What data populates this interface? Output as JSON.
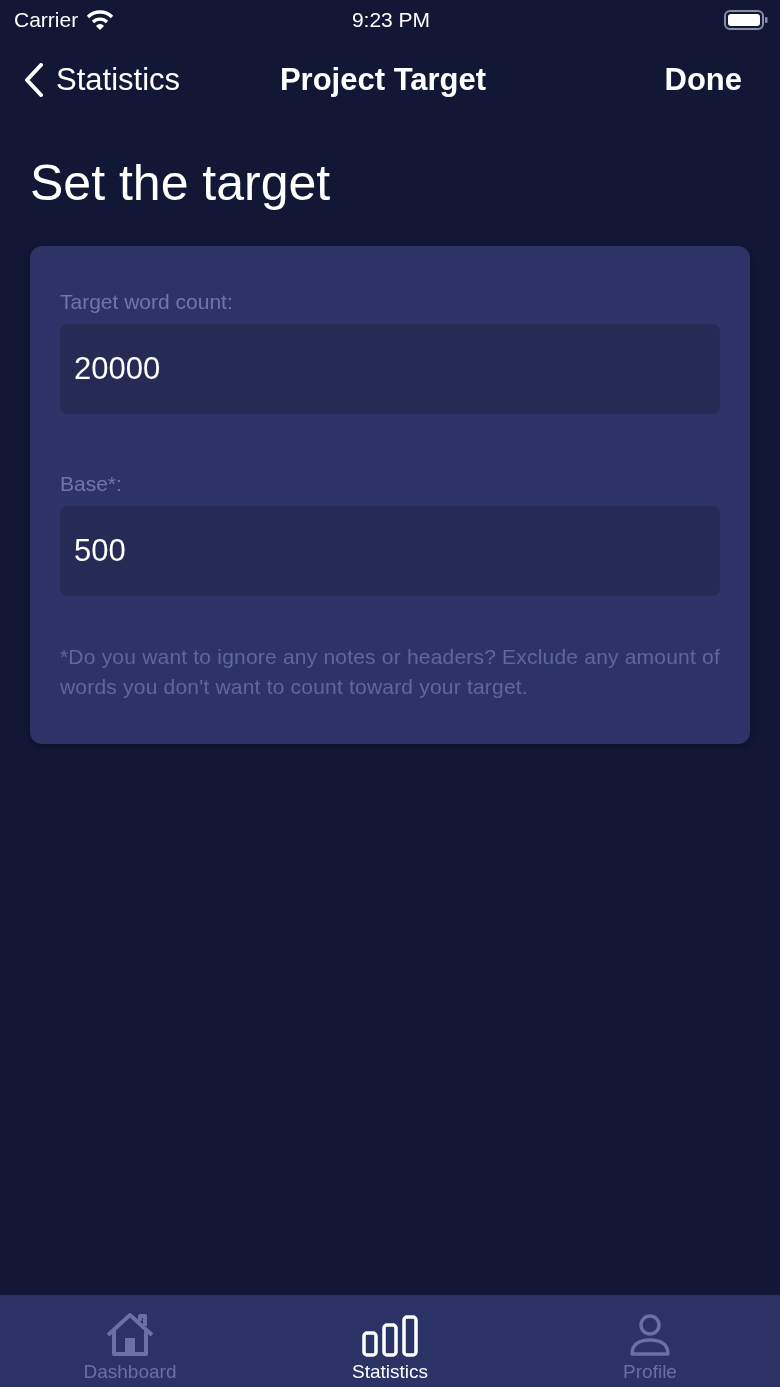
{
  "status_bar": {
    "carrier": "Carrier",
    "time": "9:23 PM"
  },
  "nav_bar": {
    "back": "Statistics",
    "title": "Project Target",
    "action": "Done"
  },
  "heading": "Set the target",
  "fields": [
    {
      "label": "Target word count:",
      "value": "20000"
    },
    {
      "label": "Base*:",
      "value": "500"
    }
  ],
  "note": "*Do you want to ignore any notes or headers? Exclude any amount of words you don't want to count toward your target.",
  "tab_bar": [
    {
      "kind": "home",
      "label": "Dashboard",
      "selected": false
    },
    {
      "kind": "stats",
      "label": "Statistics",
      "selected": true
    },
    {
      "kind": "person",
      "label": "Profile",
      "selected": false
    }
  ]
}
